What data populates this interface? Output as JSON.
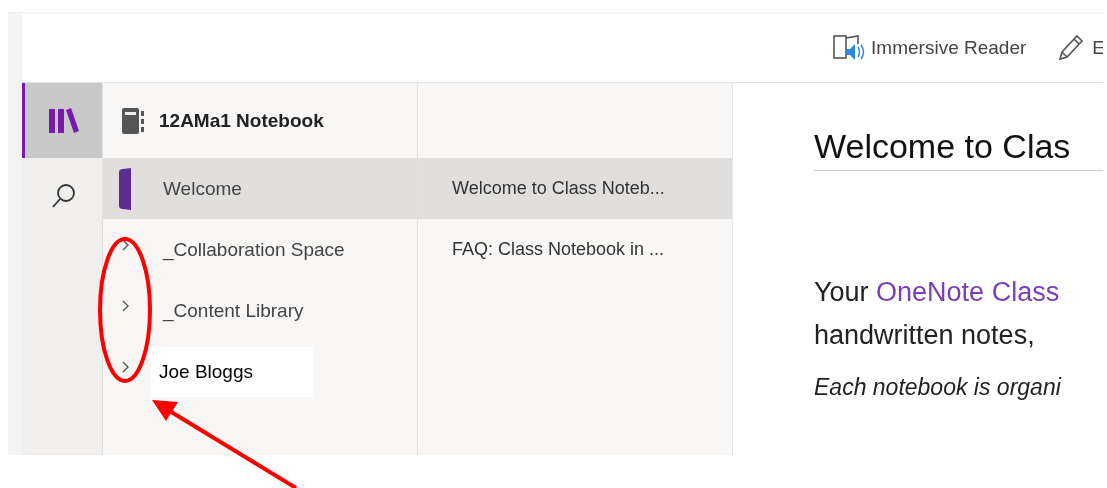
{
  "toolbar": {
    "buttons": [
      {
        "kind": "reader",
        "label": "Immersive Reader"
      },
      {
        "kind": "edit",
        "label": "E"
      }
    ]
  },
  "rail": {
    "items": [
      {
        "kind": "library",
        "selected": true
      },
      {
        "kind": "search",
        "selected": false
      }
    ]
  },
  "notebook": {
    "title": "12AMa1 Notebook"
  },
  "sections": [
    {
      "label": "Welcome",
      "selected": true,
      "kind": "tab"
    },
    {
      "label": "_Collaboration Space",
      "selected": false,
      "kind": "group"
    },
    {
      "label": "_Content Library",
      "selected": false,
      "kind": "group"
    },
    {
      "label": "Joe Bloggs",
      "selected": false,
      "kind": "pasted"
    }
  ],
  "pages": [
    {
      "label": "Welcome to Class Noteb...",
      "selected": true
    },
    {
      "label": "FAQ: Class Notebook in ...",
      "selected": false
    }
  ],
  "content": {
    "title": "Welcome to Clas",
    "paragraphs": [
      {
        "kind": "lead",
        "lines": [
          [
            {
              "text": "Your ",
              "link": false
            },
            {
              "text": "OneNote Class",
              "link": true
            }
          ],
          [
            {
              "text": "handwritten notes,",
              "link": false
            }
          ]
        ]
      },
      {
        "kind": "italic",
        "lines": [
          [
            {
              "text": "Each notebook is organi",
              "link": false
            }
          ]
        ]
      }
    ]
  }
}
